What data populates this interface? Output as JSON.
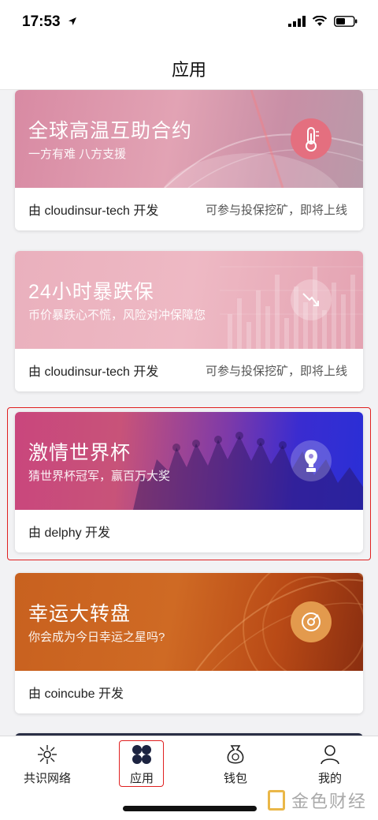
{
  "status_bar": {
    "time": "17:53"
  },
  "nav": {
    "title": "应用"
  },
  "cards": [
    {
      "title": "全球高温互助合约",
      "subtitle": "一方有难 八方支援",
      "developer": "由 cloudinsur-tech 开发",
      "status": "可参与投保挖矿，即将上线",
      "icon": "thermometer-icon"
    },
    {
      "title": "24小时暴跌保",
      "subtitle": "币价暴跌心不慌，风险对冲保障您",
      "developer": "由 cloudinsur-tech 开发",
      "status": "可参与投保挖矿，即将上线",
      "icon": "downtrend-arrow-icon"
    },
    {
      "title": "激情世界杯",
      "subtitle": "猜世界杯冠军，赢百万大奖",
      "developer": "由 delphy 开发",
      "status": "",
      "icon": "world-cup-trophy-icon"
    },
    {
      "title": "幸运大转盘",
      "subtitle": "你会成为今日幸运之星吗?",
      "developer": "由 coincube 开发",
      "status": "",
      "icon": "wheel-icon"
    }
  ],
  "tabs": [
    {
      "label": "共识网络",
      "icon": "network-icon"
    },
    {
      "label": "应用",
      "icon": "apps-icon",
      "active": true
    },
    {
      "label": "钱包",
      "icon": "wallet-bag-icon"
    },
    {
      "label": "我的",
      "icon": "profile-icon"
    }
  ],
  "watermark": {
    "text": "金色财经"
  },
  "colors": {
    "highlight": "#e02020",
    "card1_banner": "#d7849e",
    "card2_banner": "#e8a6b4",
    "card3_banner_start": "#c94a86",
    "card3_banner_end": "#2a2fd6",
    "card4_banner": "#c45a1a"
  }
}
